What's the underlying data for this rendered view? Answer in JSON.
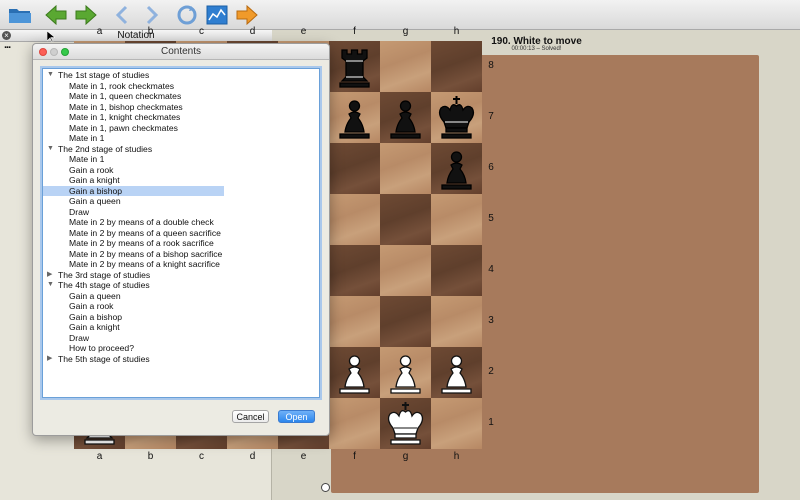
{
  "toolbar": {
    "buttons": [
      "open-folder-icon",
      "back-green-icon",
      "forward-green-icon",
      "back-blue-icon",
      "forward-blue-icon",
      "refresh-icon",
      "chart-icon",
      "forward-orange-icon"
    ]
  },
  "notation": {
    "title": "Notation",
    "dots": "..."
  },
  "dialog": {
    "title": "Contents",
    "cancel_label": "Cancel",
    "ok_label": "Open",
    "rows": [
      {
        "text": "The 1st stage of studies",
        "level": 0,
        "tri": "▼"
      },
      {
        "text": "Mate in 1, rook checkmates",
        "level": 1
      },
      {
        "text": "Mate in 1, queen checkmates",
        "level": 1
      },
      {
        "text": "Mate in 1, bishop checkmates",
        "level": 1
      },
      {
        "text": "Mate in 1, knight checkmates",
        "level": 1
      },
      {
        "text": "Mate in 1, pawn checkmates",
        "level": 1
      },
      {
        "text": "Mate in 1",
        "level": 1
      },
      {
        "text": "The 2nd stage of studies",
        "level": 0,
        "tri": "▼"
      },
      {
        "text": "Mate in 1",
        "level": 1
      },
      {
        "text": "Gain a rook",
        "level": 1
      },
      {
        "text": "Gain a knight",
        "level": 1
      },
      {
        "text": "Gain a bishop",
        "level": 1,
        "selected": true
      },
      {
        "text": "Gain a queen",
        "level": 1
      },
      {
        "text": "Draw",
        "level": 1
      },
      {
        "text": "Mate in 2 by means of a double check",
        "level": 1
      },
      {
        "text": "Mate in 2 by means of a queen sacrifice",
        "level": 1
      },
      {
        "text": "Mate in 2 by means of a rook sacrifice",
        "level": 1
      },
      {
        "text": "Mate in 2 by means of a bishop sacrifice",
        "level": 1
      },
      {
        "text": "Mate in 2 by means of a knight sacrifice",
        "level": 1
      },
      {
        "text": "The 3rd stage of studies",
        "level": 0,
        "tri": "▶"
      },
      {
        "text": "The 4th stage of studies",
        "level": 0,
        "tri": "▼"
      },
      {
        "text": "Gain a queen",
        "level": 1
      },
      {
        "text": "Gain a rook",
        "level": 1
      },
      {
        "text": "Gain a bishop",
        "level": 1
      },
      {
        "text": "Gain a knight",
        "level": 1
      },
      {
        "text": "Draw",
        "level": 1
      },
      {
        "text": "How to proceed?",
        "level": 1
      },
      {
        "text": "The 5th stage of studies",
        "level": 0,
        "tri": "▶"
      }
    ]
  },
  "puzzle": {
    "title": "190. White to move",
    "status": "00:00:13 – Solved!"
  },
  "board": {
    "files": [
      "a",
      "b",
      "c",
      "d",
      "e",
      "f",
      "g",
      "h"
    ],
    "ranks": [
      "8",
      "7",
      "6",
      "5",
      "4",
      "3",
      "2",
      "1"
    ],
    "pieces": [
      {
        "square": "a8",
        "piece": "rook",
        "color": "black"
      },
      {
        "square": "f8",
        "piece": "rook",
        "color": "black"
      },
      {
        "square": "a7",
        "piece": "pawn",
        "color": "black"
      },
      {
        "square": "b7",
        "piece": "pawn",
        "color": "black"
      },
      {
        "square": "d7",
        "piece": "rook",
        "color": "white"
      },
      {
        "square": "f7",
        "piece": "pawn",
        "color": "black"
      },
      {
        "square": "g7",
        "piece": "pawn",
        "color": "black"
      },
      {
        "square": "h7",
        "piece": "king",
        "color": "black"
      },
      {
        "square": "b6",
        "piece": "queen",
        "color": "black"
      },
      {
        "square": "e6",
        "piece": "pawn",
        "color": "black"
      },
      {
        "square": "h6",
        "piece": "pawn",
        "color": "black"
      },
      {
        "square": "e5",
        "piece": "pawn",
        "color": "white"
      },
      {
        "square": "b4",
        "piece": "pawn",
        "color": "white"
      },
      {
        "square": "d4",
        "piece": "bishop",
        "color": "black"
      },
      {
        "square": "a3",
        "piece": "pawn",
        "color": "white"
      },
      {
        "square": "c3",
        "piece": "knight",
        "color": "white"
      },
      {
        "square": "e2",
        "piece": "queen",
        "color": "white"
      },
      {
        "square": "f2",
        "piece": "pawn",
        "color": "white"
      },
      {
        "square": "g2",
        "piece": "pawn",
        "color": "white"
      },
      {
        "square": "h2",
        "piece": "pawn",
        "color": "white"
      },
      {
        "square": "a1",
        "piece": "rook",
        "color": "white"
      },
      {
        "square": "g1",
        "piece": "king",
        "color": "white"
      }
    ]
  },
  "colors": {
    "accent": "#2c86ec",
    "selection": "#b9d3f5"
  }
}
